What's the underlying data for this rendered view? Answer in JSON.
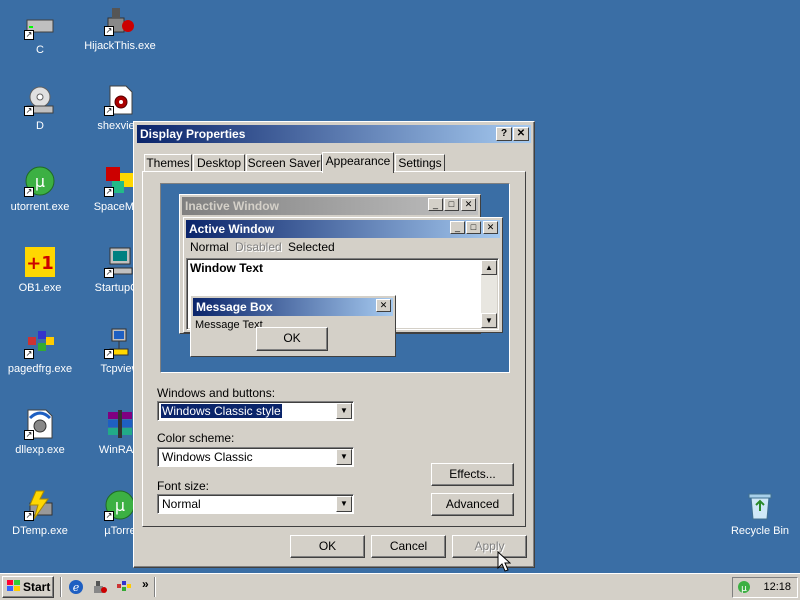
{
  "desktop": {
    "icons": [
      {
        "label": "C",
        "icon": "drive-icon"
      },
      {
        "label": "HijackThis.exe",
        "icon": "hijackthis-icon"
      },
      {
        "label": "D",
        "icon": "cd-drive-icon"
      },
      {
        "label": "shexview",
        "icon": "gear-file-icon"
      },
      {
        "label": "utorrent.exe",
        "icon": "utorrent-icon"
      },
      {
        "label": "SpaceMon",
        "icon": "spacemonger-icon"
      },
      {
        "label": "OB1.exe",
        "icon": "ob1-icon"
      },
      {
        "label": "StartupCP",
        "icon": "computer-icon"
      },
      {
        "label": "pagedfrg.exe",
        "icon": "defrag-icon"
      },
      {
        "label": "Tcpview",
        "icon": "network-icon"
      },
      {
        "label": "dllexp.exe",
        "icon": "dllexp-icon"
      },
      {
        "label": "WinRAR",
        "icon": "winrar-icon"
      },
      {
        "label": "DTemp.exe",
        "icon": "dtemp-icon"
      },
      {
        "label": "µTorre",
        "icon": "utorrent-icon"
      },
      {
        "label": "Recycle Bin",
        "icon": "recycle-bin-icon"
      }
    ]
  },
  "dialog": {
    "title": "Display Properties",
    "help_btn": "?",
    "close_btn": "✕",
    "tabs": [
      "Themes",
      "Desktop",
      "Screen Saver",
      "Appearance",
      "Settings"
    ],
    "active_tab": "Appearance",
    "preview": {
      "inactive_title": "Inactive Window",
      "active_title": "Active Window",
      "menu_normal": "Normal",
      "menu_disabled": "Disabled",
      "menu_selected": "Selected",
      "window_text": "Window Text",
      "msgbox_title": "Message Box",
      "msgbox_text": "Message Text",
      "msgbox_ok": "OK"
    },
    "windows_buttons_label": "Windows and buttons:",
    "windows_buttons_value": "Windows Classic style",
    "color_scheme_label": "Color scheme:",
    "color_scheme_value": "Windows Classic",
    "font_size_label": "Font size:",
    "font_size_value": "Normal",
    "effects_btn": "Effects...",
    "advanced_btn": "Advanced",
    "ok_btn": "OK",
    "cancel_btn": "Cancel",
    "apply_btn": "Apply"
  },
  "taskbar": {
    "start_label": "Start",
    "chevron": "»",
    "clock": "12:18"
  },
  "colors": {
    "desktop": "#3a6ea5",
    "active_title": "#0a246a",
    "inactive_title": "#808080",
    "face": "#d4d0c8",
    "selection": "#0a246a"
  }
}
